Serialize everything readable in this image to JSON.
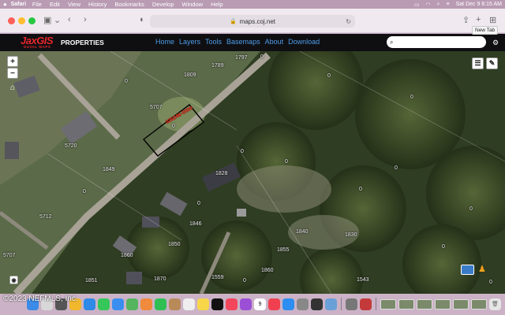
{
  "menubar": {
    "apple": "",
    "items": [
      "Safari",
      "File",
      "Edit",
      "View",
      "History",
      "Bookmarks",
      "Develop",
      "Window",
      "Help"
    ],
    "clock": "Sat Dec 9  8:15 AM"
  },
  "browser": {
    "url": "maps.coj.net",
    "tooltip": "New Tab"
  },
  "app": {
    "logo_text": "JaxGIS",
    "logo_sub": "DUVAL MAPS",
    "section": "PROPERTIES",
    "nav": [
      "Home",
      "Layers",
      "Tools",
      "Basemaps",
      "About",
      "Download"
    ],
    "search_placeholder": ""
  },
  "map": {
    "parcel_id": "026346-0000",
    "labels": [
      {
        "text": "1797"
      },
      {
        "text": "1809"
      },
      {
        "text": "1789"
      },
      {
        "text": "5707"
      },
      {
        "text": "0"
      },
      {
        "text": "0"
      },
      {
        "text": "5720"
      },
      {
        "text": "1849"
      },
      {
        "text": "0"
      },
      {
        "text": "1828"
      },
      {
        "text": "0"
      },
      {
        "text": "0"
      },
      {
        "text": "0"
      },
      {
        "text": "0"
      },
      {
        "text": "0"
      },
      {
        "text": "5712"
      },
      {
        "text": "0"
      },
      {
        "text": "0"
      },
      {
        "text": "0"
      },
      {
        "text": "0"
      },
      {
        "text": "1846"
      },
      {
        "text": "1840"
      },
      {
        "text": "1830"
      },
      {
        "text": "5707"
      },
      {
        "text": "1860"
      },
      {
        "text": "1850"
      },
      {
        "text": "1855"
      },
      {
        "text": "1860"
      },
      {
        "text": "1851"
      },
      {
        "text": "1870"
      },
      {
        "text": "1559"
      },
      {
        "text": "0"
      },
      {
        "text": "1543"
      },
      {
        "text": "0"
      },
      {
        "text": "0"
      }
    ]
  },
  "watermark": "©2023 NEFMLS, Inc.",
  "dock": {
    "apps": [
      {
        "name": "finder",
        "color": "#3c8be8"
      },
      {
        "name": "launchpad",
        "color": "#d8d8d8"
      },
      {
        "name": "mission-control",
        "color": "#555"
      },
      {
        "name": "chrome",
        "color": "#f1b82d"
      },
      {
        "name": "safari",
        "color": "#2e8ae6"
      },
      {
        "name": "messages",
        "color": "#35c759"
      },
      {
        "name": "mail",
        "color": "#3a8ef0"
      },
      {
        "name": "maps",
        "color": "#55b45e"
      },
      {
        "name": "photos",
        "color": "#f08a3c"
      },
      {
        "name": "facetime",
        "color": "#2fbf55"
      },
      {
        "name": "contacts",
        "color": "#b88a5a"
      },
      {
        "name": "reminders",
        "color": "#eeeeee"
      },
      {
        "name": "notes",
        "color": "#f7d64a"
      },
      {
        "name": "tv",
        "color": "#111"
      },
      {
        "name": "music",
        "color": "#f3455c"
      },
      {
        "name": "podcasts",
        "color": "#9b4fd6"
      },
      {
        "name": "calendar",
        "color": "#ffffff"
      },
      {
        "name": "news",
        "color": "#f0404f"
      },
      {
        "name": "app-store",
        "color": "#2b8ef0"
      },
      {
        "name": "system-settings",
        "color": "#888"
      },
      {
        "name": "chess",
        "color": "#333"
      },
      {
        "name": "preview",
        "color": "#6aa0d8"
      },
      {
        "name": "image-capture",
        "color": "#777"
      },
      {
        "name": "photo-booth",
        "color": "#c43a3a"
      }
    ],
    "calendar_day": "9"
  }
}
